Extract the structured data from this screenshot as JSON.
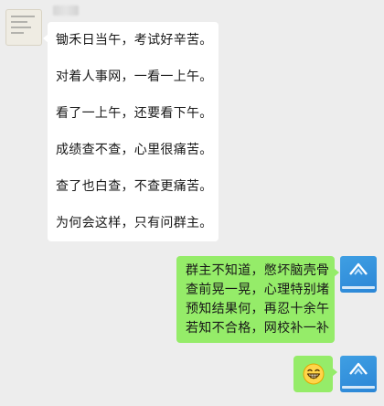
{
  "colors": {
    "background": "#ededed",
    "incoming_bubble": "#ffffff",
    "outgoing_bubble": "#95ec69",
    "avatar_accent": "#2b86d6"
  },
  "incoming": {
    "avatar_icon": "handwritten-note-avatar",
    "lines": [
      "锄禾日当午，考试好辛苦。",
      "对着人事网，一看一上午。",
      "看了一上午，还要看下午。",
      "成绩查不查，心里很痛苦。",
      "查了也白查，不查更痛苦。",
      "为何会这样，只有问群主。"
    ]
  },
  "outgoing": {
    "avatar_icon": "blue-logo-avatar",
    "lines": [
      "群主不知道，憋坏脑壳骨",
      "查前晃一晃，心理特别堵",
      "预知结果何，再忍十余午",
      "若知不合格，网校补一补"
    ],
    "emoji": "grinning-face-emoji"
  }
}
